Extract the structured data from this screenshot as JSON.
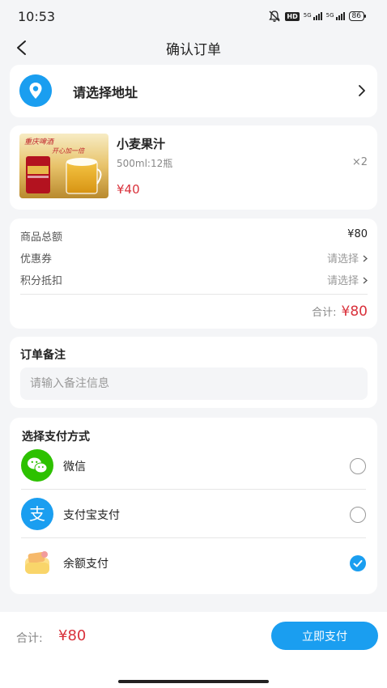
{
  "status_bar": {
    "time": "10:53",
    "hd": "HD",
    "signal1": "5G",
    "signal2": "5G",
    "battery": "86"
  },
  "nav": {
    "title": "确认订单",
    "back_icon": "chevron-left-icon"
  },
  "address": {
    "placeholder": "请选择地址",
    "icon": "location-pin-icon"
  },
  "product": {
    "name": "小麦果汁",
    "spec": "500ml:12瓶",
    "quantity": "×2",
    "price": "¥40",
    "image_text": "重庆啤酒 开心加一倍"
  },
  "summary": {
    "goods_total_label": "商品总额",
    "goods_total_value": "¥80",
    "coupon_label": "优惠券",
    "coupon_value": "请选择",
    "points_label": "积分抵扣",
    "points_value": "请选择",
    "total_label": "合计:",
    "total_value": "¥80"
  },
  "note": {
    "title": "订单备注",
    "placeholder": "请输入备注信息"
  },
  "payment": {
    "title": "选择支付方式",
    "methods": [
      {
        "label": "微信",
        "icon": "wechat-icon",
        "selected": false
      },
      {
        "label": "支付宝支付",
        "icon": "alipay-icon",
        "selected": false
      },
      {
        "label": "余额支付",
        "icon": "wallet-icon",
        "selected": true
      }
    ]
  },
  "bottom_bar": {
    "total_label": "合计:",
    "total_value": "¥80",
    "pay_button": "立即支付"
  },
  "colors": {
    "accent": "#1a9ef0",
    "price": "#d9313b",
    "background": "#f4f5f7",
    "wechat": "#2dc100"
  }
}
